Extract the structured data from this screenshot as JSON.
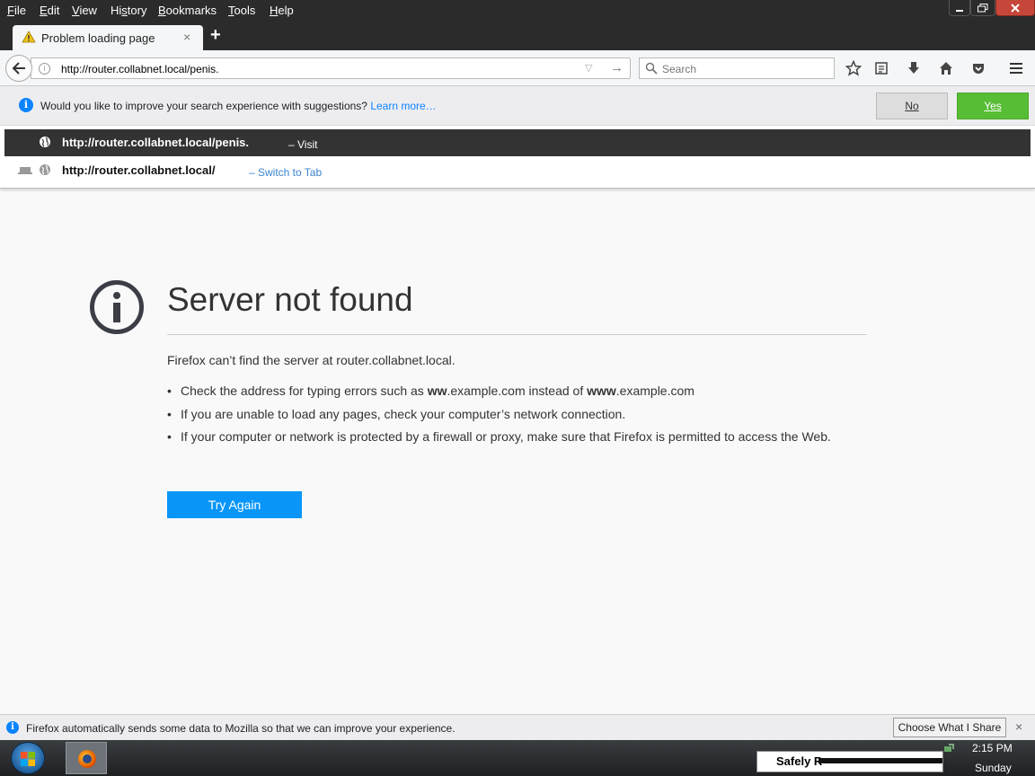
{
  "menu": [
    "File",
    "Edit",
    "View",
    "History",
    "Bookmarks",
    "Tools",
    "Help"
  ],
  "menu_accel": [
    "F",
    "E",
    "V",
    "s",
    "B",
    "T",
    "H"
  ],
  "tab": {
    "title": "Problem loading page",
    "close": "×",
    "new_tab": "+"
  },
  "navbar": {
    "url": "http://router.collabnet.local/penis.",
    "search_placeholder": "Search"
  },
  "suggest_bar": {
    "message": "Would you like to improve your search experience with suggestions?",
    "link": "Learn more…",
    "no_label": "No",
    "yes_label": "Yes"
  },
  "popup": {
    "rows": [
      {
        "url": "http://router.collabnet.local/penis.",
        "action": "– Visit"
      },
      {
        "url": "http://router.collabnet.local/",
        "action": "– Switch to Tab"
      }
    ]
  },
  "error": {
    "title": "Server not found",
    "description": "Firefox can’t find the server at router.collabnet.local.",
    "bullets": [
      {
        "pre": "Check the address for typing errors such as ",
        "b1": "ww",
        "mid": ".example.com instead of ",
        "b2": "www",
        "post": ".example.com"
      },
      {
        "text": "If you are unable to load any pages, check your computer’s network connection."
      },
      {
        "text": "If your computer or network is protected by a firewall or proxy, make sure that Firefox is permitted to access the Web."
      }
    ],
    "try_again": "Try Again"
  },
  "data_notice": {
    "message": "Firefox automatically sends some data to Mozilla so that we can improve your experience.",
    "button": "Choose What I Share",
    "close": "×"
  },
  "taskbar": {
    "safely_text": "Safely R",
    "time": "2:15 PM",
    "day": "Sunday"
  },
  "colors": {
    "accent_blue": "#0996f8",
    "yes_green": "#57bd35",
    "titlebar": "#2b2b2b"
  }
}
